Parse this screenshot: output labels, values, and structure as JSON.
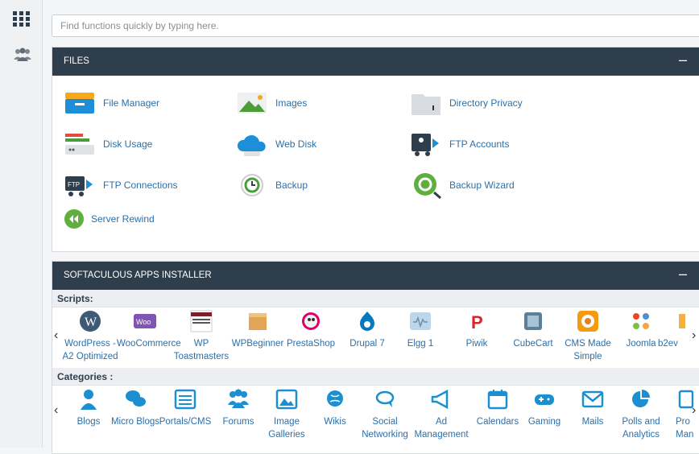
{
  "search": {
    "placeholder": "Find functions quickly by typing here."
  },
  "files": {
    "title": "FILES",
    "collapse": "–",
    "items": [
      {
        "label": "File Manager"
      },
      {
        "label": "Images"
      },
      {
        "label": "Directory Privacy"
      },
      {
        "label": "Disk Usage"
      },
      {
        "label": "Web Disk"
      },
      {
        "label": "FTP Accounts"
      },
      {
        "label": "FTP Connections"
      },
      {
        "label": "Backup"
      },
      {
        "label": "Backup Wizard"
      },
      {
        "label": "Server Rewind"
      }
    ]
  },
  "softaculous": {
    "title": "SOFTACULOUS APPS INSTALLER",
    "collapse": "–",
    "scripts_label": "Scripts:",
    "categories_label": "Categories :",
    "scripts": [
      "WordPress - A2 Optimized",
      "WooCommerce",
      "WP Toastmasters",
      "WPBeginner",
      "PrestaShop",
      "Drupal 7",
      "Elgg 1",
      "Piwik",
      "CubeCart",
      "CMS Made Simple",
      "Joomla",
      "b2ev"
    ],
    "categories": [
      "Blogs",
      "Micro Blogs",
      "Portals/CMS",
      "Forums",
      "Image Galleries",
      "Wikis",
      "Social Networking",
      "Ad Management",
      "Calendars",
      "Gaming",
      "Mails",
      "Polls and Analytics",
      "Pro Manag"
    ]
  },
  "icons": {
    "app_grid": "app-grid-icon",
    "users": "users-icon",
    "prev": "‹",
    "next": "›"
  },
  "colors": {
    "header": "#2f3e4d",
    "link": "#2d6fa8",
    "accent": "#1b8fd0"
  }
}
